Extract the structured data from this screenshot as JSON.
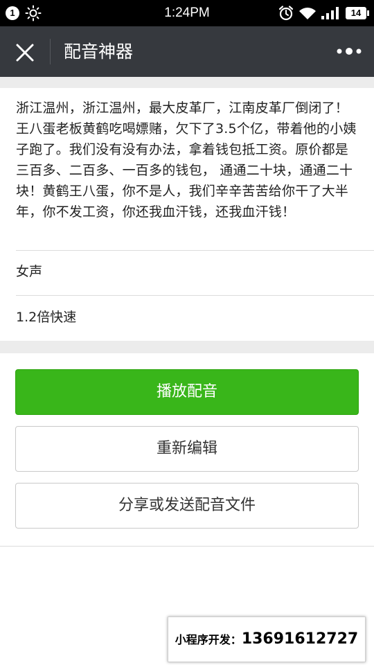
{
  "status_bar": {
    "notification_count": "1",
    "time": "1:24PM",
    "battery": "14"
  },
  "nav": {
    "title": "配音神器"
  },
  "script": {
    "text": "浙江温州，浙江温州，最大皮革厂，江南皮革厂倒闭了！王八蛋老板黄鹤吃喝嫖赌，欠下了3.5个亿，带着他的小姨子跑了。我们没有没有办法，拿着钱包抵工资。原价都是三百多、二百多、一百多的钱包， 通通二十块，通通二十块！黄鹤王八蛋，你不是人，我们辛辛苦苦给你干了大半年，你不发工资，你还我血汗钱，还我血汗钱！"
  },
  "settings": {
    "voice": "女声",
    "speed": "1.2倍快速"
  },
  "actions": {
    "play_label": "播放配音",
    "edit_label": "重新编辑",
    "share_label": "分享或发送配音文件"
  },
  "dev_banner": {
    "label": "小程序开发：",
    "phone": "13691612727"
  },
  "colors": {
    "primary_green": "#39b61a",
    "nav_bg": "#36393e"
  }
}
